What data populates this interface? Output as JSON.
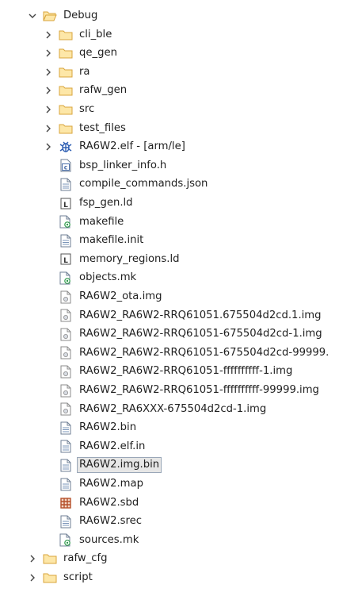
{
  "tree": {
    "root": {
      "label": "Debug",
      "icon": "folder-open-icon"
    },
    "folders": [
      {
        "label": "cli_ble",
        "icon": "folder-icon"
      },
      {
        "label": "qe_gen",
        "icon": "folder-icon"
      },
      {
        "label": "ra",
        "icon": "folder-icon"
      },
      {
        "label": "rafw_gen",
        "icon": "folder-icon"
      },
      {
        "label": "src",
        "icon": "folder-icon"
      },
      {
        "label": "test_files",
        "icon": "folder-icon"
      }
    ],
    "elf": {
      "label": "RA6W2.elf - [arm/le]",
      "icon": "binary-elf-icon"
    },
    "files": [
      {
        "label": "bsp_linker_info.h",
        "icon": "c-header-icon"
      },
      {
        "label": "compile_commands.json",
        "icon": "text-file-icon"
      },
      {
        "label": "fsp_gen.ld",
        "icon": "linker-script-icon"
      },
      {
        "label": "makefile",
        "icon": "makefile-icon"
      },
      {
        "label": "makefile.init",
        "icon": "text-file-icon"
      },
      {
        "label": "memory_regions.ld",
        "icon": "linker-script-icon"
      },
      {
        "label": "objects.mk",
        "icon": "makefile-icon"
      },
      {
        "label": "RA6W2_ota.img",
        "icon": "image-file-icon"
      },
      {
        "label": "RA6W2_RA6W2-RRQ61051.675504d2cd.1.img",
        "icon": "image-file-icon"
      },
      {
        "label": "RA6W2_RA6W2-RRQ61051-675504d2cd-1.img",
        "icon": "image-file-icon"
      },
      {
        "label": "RA6W2_RA6W2-RRQ61051-675504d2cd-99999.",
        "icon": "image-file-icon"
      },
      {
        "label": "RA6W2_RA6W2-RRQ61051-ffffffffff-1.img",
        "icon": "image-file-icon"
      },
      {
        "label": "RA6W2_RA6W2-RRQ61051-ffffffffff-99999.img",
        "icon": "image-file-icon"
      },
      {
        "label": "RA6W2_RA6XXX-675504d2cd-1.img",
        "icon": "image-file-icon"
      },
      {
        "label": "RA6W2.bin",
        "icon": "text-file-icon"
      },
      {
        "label": "RA6W2.elf.in",
        "icon": "text-file-icon"
      },
      {
        "label": "RA6W2.img.bin",
        "icon": "text-file-icon",
        "selected": true
      },
      {
        "label": "RA6W2.map",
        "icon": "text-file-icon"
      },
      {
        "label": "RA6W2.sbd",
        "icon": "sbd-file-icon"
      },
      {
        "label": "RA6W2.srec",
        "icon": "text-file-icon"
      },
      {
        "label": "sources.mk",
        "icon": "makefile-icon"
      }
    ],
    "siblings": [
      {
        "label": "rafw_cfg",
        "icon": "folder-icon"
      },
      {
        "label": "script",
        "icon": "folder-icon"
      }
    ]
  },
  "colors": {
    "folder_fill": "#fde7a8",
    "folder_stroke": "#d9a53c",
    "chevron": "#444444",
    "selection_bg": "#e6e6e6",
    "selection_border": "#9aa7b8",
    "c_header": "#4a6ea8",
    "elf_icon": "#2f5fb3",
    "makefile_accent": "#2e9b4b",
    "sbd_icon": "#b5502a"
  }
}
